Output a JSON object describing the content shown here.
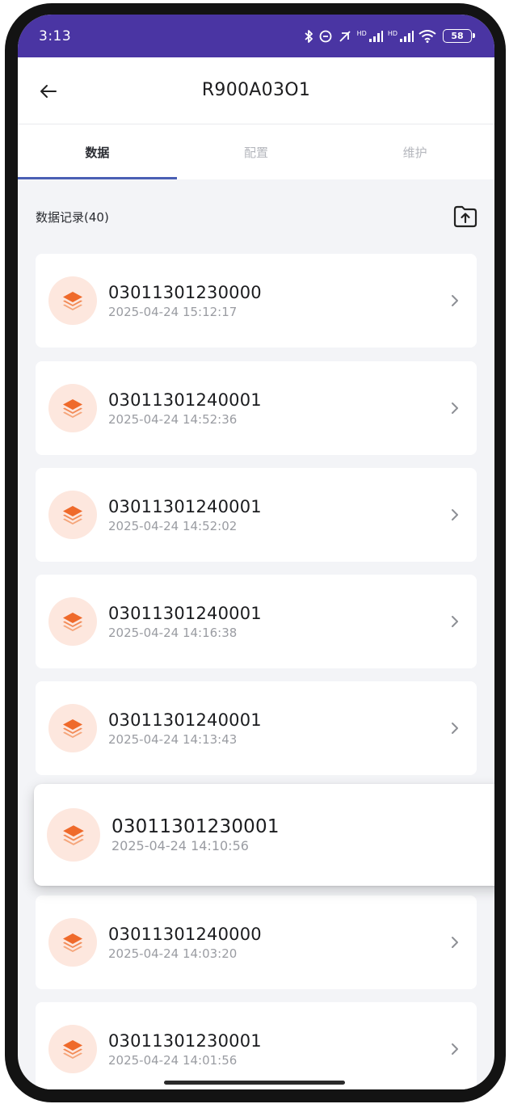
{
  "status_bar": {
    "time": "3:13",
    "signal_tag_1": "HD",
    "signal_tag_2": "HD",
    "battery": "58"
  },
  "app_bar": {
    "title": "R900A03O1",
    "back_icon": "arrow-left-icon"
  },
  "tabs": [
    {
      "label": "数据",
      "active": true
    },
    {
      "label": "配置",
      "active": false
    },
    {
      "label": "维护",
      "active": false
    }
  ],
  "section": {
    "title": "数据记录(40)",
    "export_icon": "upload-folder-icon"
  },
  "records": [
    {
      "id": "03011301230000",
      "time": "2025-04-24 15:12:17"
    },
    {
      "id": "03011301240001",
      "time": "2025-04-24 14:52:36"
    },
    {
      "id": "03011301240001",
      "time": "2025-04-24 14:52:02"
    },
    {
      "id": "03011301240001",
      "time": "2025-04-24 14:16:38"
    },
    {
      "id": "03011301240001",
      "time": "2025-04-24 14:13:43"
    },
    {
      "id": "03011301230001",
      "time": "2025-04-24 14:10:56"
    },
    {
      "id": "03011301240000",
      "time": "2025-04-24 14:03:20"
    },
    {
      "id": "03011301230001",
      "time": "2025-04-24 14:01:56"
    }
  ],
  "colors": {
    "status_bar": "#4a35a3",
    "accent": "#ef6a2b",
    "tab_indicator": "#4a5fb4",
    "avatar_bg": "#fde7de"
  }
}
